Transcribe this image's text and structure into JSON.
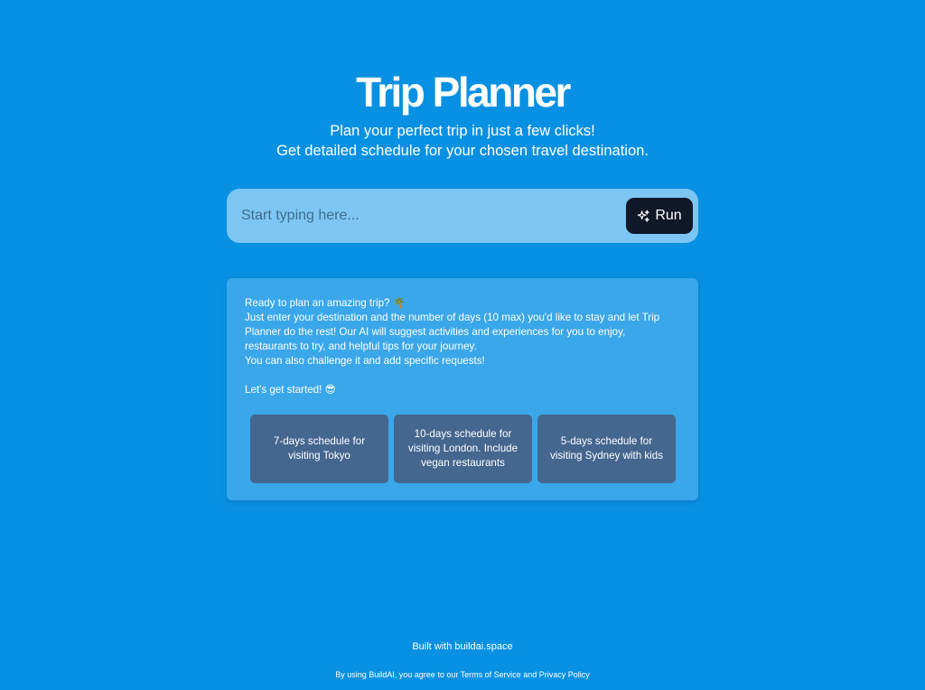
{
  "header": {
    "title": "Trip Planner",
    "subtitle_line1": "Plan your perfect trip in just a few clicks!",
    "subtitle_line2": "Get detailed schedule for your chosen travel destination."
  },
  "search": {
    "value": "",
    "placeholder": "Start typing here...",
    "run_label": "Run",
    "run_icon": "sparkles-icon"
  },
  "info": {
    "line1": "Ready to plan an amazing trip? 🌴",
    "line2": "Just enter your destination and the number of days (10 max) you'd like to stay and let Trip",
    "line3": "Planner do the rest! Our AI will suggest activities and experiences for you to enjoy,",
    "line4": "restaurants to try, and helpful tips for your journey.",
    "line5": "You can also challenge it and add specific requests!",
    "line6": "Let's get started! 😎"
  },
  "suggestions": [
    {
      "label": "7-days schedule for visiting Tokyo"
    },
    {
      "label": "10-days schedule for visiting London. Include vegan restaurants"
    },
    {
      "label": "5-days schedule for visiting Sydney with kids"
    }
  ],
  "footer": {
    "built_prefix": "Built with ",
    "built_link": "buildai.space",
    "legal_prefix": "By using BuildAI, you agree to our ",
    "terms_link": "Terms of Service",
    "legal_and": " and ",
    "privacy_link": "Privacy Policy"
  },
  "colors": {
    "background": "#0891e2",
    "search_bg": "#7dc6f3",
    "run_button_bg": "#111827",
    "card_bg": "#3aa7ea",
    "suggestion_bg": "#45668f"
  }
}
